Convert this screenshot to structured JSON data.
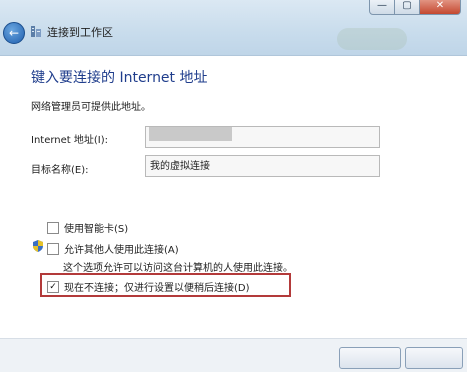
{
  "window": {
    "title": "连接到工作区",
    "controls": {
      "minimize": "—",
      "maximize": "▢",
      "close": "✕"
    }
  },
  "nav": {
    "back_icon": "←"
  },
  "main": {
    "heading": "键入要连接的 Internet 地址",
    "description": "网络管理员可提供此地址。",
    "internet_address_label": "Internet 地址(I):",
    "internet_address_value": "",
    "destination_name_label": "目标名称(E):",
    "destination_name_value": "我的虚拟连接",
    "options": {
      "smart_card": {
        "label": "使用智能卡(S)",
        "checked": false
      },
      "allow_others": {
        "label": "允许其他人使用此连接(A)",
        "checked": false
      },
      "allow_others_note": "这个选项允许可以访问这台计算机的人使用此连接。",
      "dont_connect_now": {
        "label": "现在不连接；仅进行设置以便稍后连接(D)",
        "checked": true,
        "check_glyph": "✓"
      }
    }
  },
  "colors": {
    "heading": "#1f3d8c",
    "highlight_border": "#b33a3a",
    "titlebar": "#c8dcec"
  }
}
